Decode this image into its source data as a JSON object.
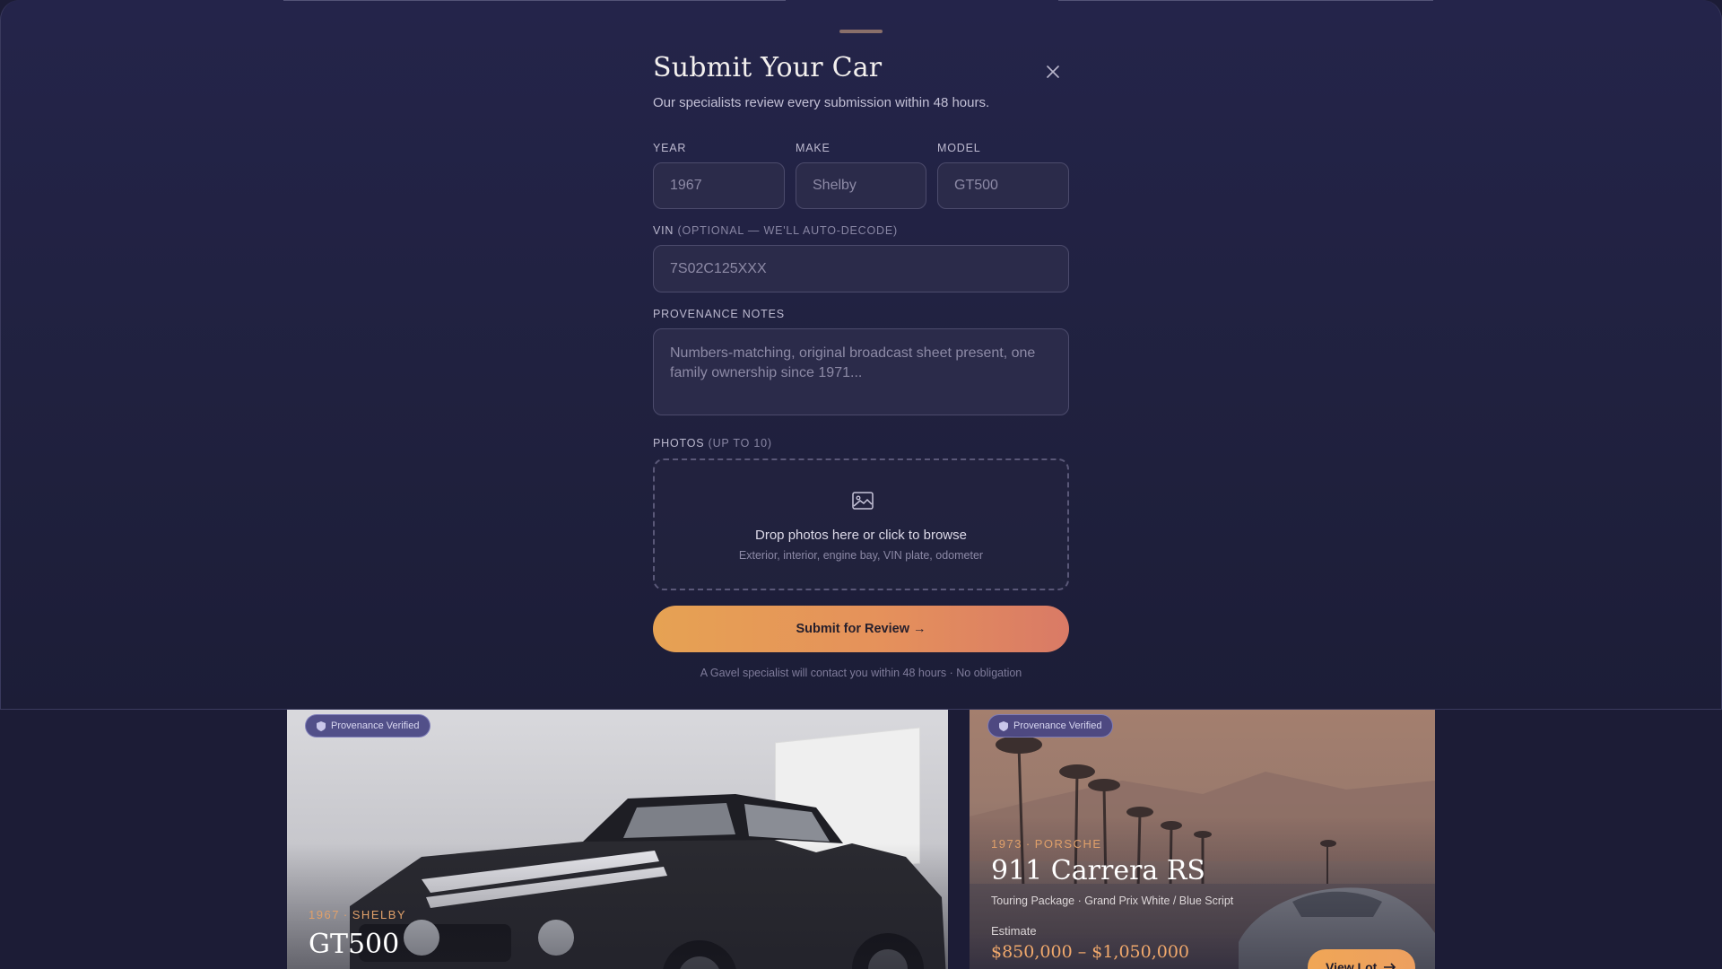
{
  "modal": {
    "title": "Submit Your Car",
    "subtitle": "Our specialists review every submission within 48 hours.",
    "close_icon": "close-icon",
    "fields": {
      "year": {
        "label": "YEAR",
        "placeholder": "1967"
      },
      "make": {
        "label": "MAKE",
        "placeholder": "Shelby"
      },
      "model": {
        "label": "MODEL",
        "placeholder": "GT500"
      },
      "vin": {
        "label": "VIN",
        "label_note": "(OPTIONAL — WE'LL AUTO-DECODE)",
        "placeholder": "7S02C125XXX"
      },
      "notes": {
        "label": "PROVENANCE NOTES",
        "placeholder": "Numbers-matching, original broadcast sheet present, one family ownership since 1971..."
      },
      "photos": {
        "label": "PHOTOS",
        "label_note": "(UP TO 10)"
      }
    },
    "dropzone": {
      "icon": "image-icon",
      "title": "Drop photos here or click to browse",
      "hint": "Exterior, interior, engine bay, VIN plate, odometer"
    },
    "submit_label": "Submit for Review →",
    "footnote": "A Gavel specialist will contact you within 48 hours · No obligation"
  },
  "listings": [
    {
      "badge": "Provenance Verified",
      "year": "1967",
      "make": "SHELBY",
      "title": "GT500"
    },
    {
      "badge": "Provenance Verified",
      "year": "1973",
      "make": "PORSCHE",
      "title": "911 Carrera RS",
      "subtitle": "Touring Package · Grand Prix White / Blue Script",
      "estimate_label": "Estimate",
      "estimate_value": "$850,000 – $1,050,000",
      "view_label": "View Lot"
    }
  ],
  "colors": {
    "accent": "#e6a253",
    "accent_end": "#d97a66",
    "sheet_bg": "#22223f",
    "badge_bg": "#46448a"
  }
}
